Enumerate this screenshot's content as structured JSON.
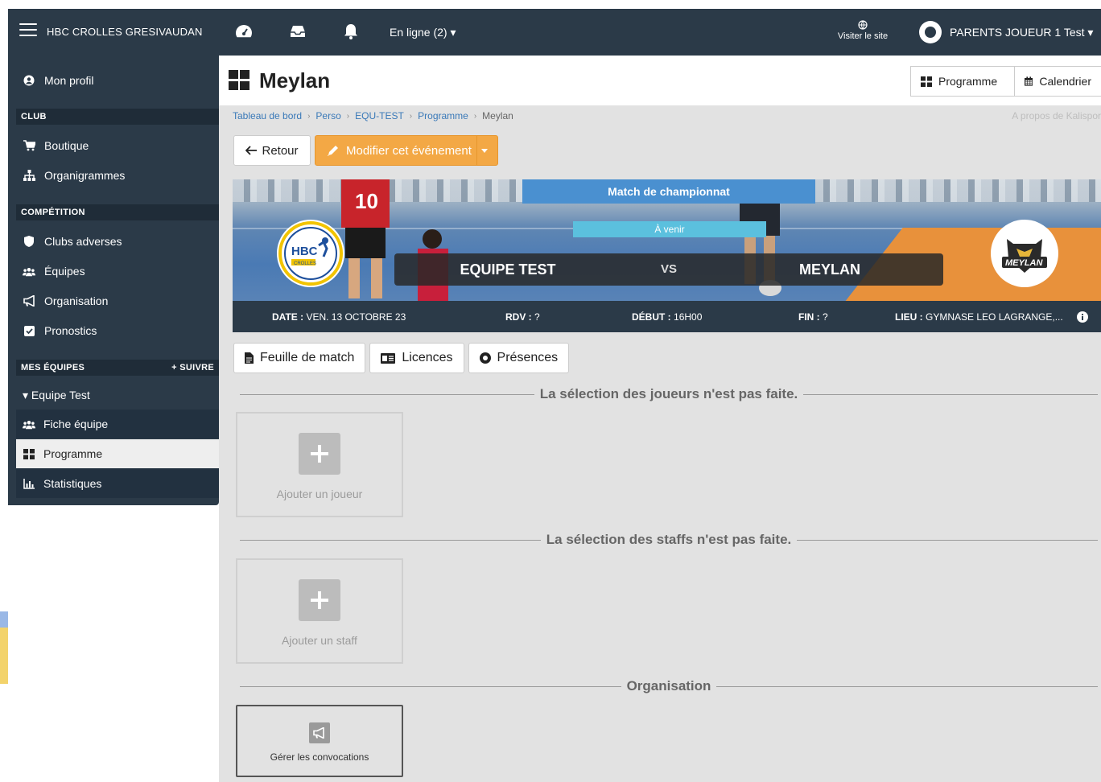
{
  "topbar": {
    "brand": "HBC CROLLES GRESIVAUDAN",
    "online_label": "En ligne (2) ▾",
    "visit_site": "Visiter le site",
    "user_name": "PARENTS JOUEUR 1 Test ▾",
    "icons": [
      "menu-icon",
      "dashboard-icon",
      "inbox-icon",
      "bell-icon",
      "globe-icon",
      "avatar"
    ]
  },
  "sidebar": {
    "profile": "Mon profil",
    "sections": {
      "club": "CLUB",
      "competition": "COMPÉTITION",
      "my_teams": "MES ÉQUIPES",
      "follow": "+ SUIVRE"
    },
    "club_items": [
      "Boutique",
      "Organigrammes"
    ],
    "competition_items": [
      "Clubs adverses",
      "Équipes",
      "Organisation",
      "Pronostics"
    ],
    "team_name": "▾  Equipe Test",
    "team_items": [
      "Fiche équipe",
      "Programme",
      "Statistiques"
    ]
  },
  "page": {
    "title": "Meylan",
    "btn_programme": "Programme",
    "btn_calendar": "Calendrier",
    "breadcrumb": [
      "Tableau de bord",
      "Perso",
      "EQU-TEST",
      "Programme",
      "Meylan"
    ],
    "about": "A propos de Kalispor",
    "back": "Retour",
    "edit": "Modifier cet événement"
  },
  "match": {
    "type": "Match de championnat",
    "status": "À venir",
    "home": "EQUIPE TEST",
    "vs": "VS",
    "away": "MEYLAN",
    "date_label": "DATE :",
    "date": "VEN. 13 OCTOBRE 23",
    "rdv_label": "RDV :",
    "rdv": "?",
    "start_label": "DÉBUT :",
    "start": "16H00",
    "end_label": "FIN :",
    "end": "?",
    "place_label": "LIEU :",
    "place": "GYMNASE LEO LAGRANGE,...",
    "home_logo": "HBC",
    "home_logo_sub": "CROLLES",
    "away_logo": "MEYLAN"
  },
  "tabs": [
    "Feuille de match",
    "Licences",
    "Présences"
  ],
  "sections": {
    "players_title": "La sélection des joueurs n'est pas faite.",
    "add_player": "Ajouter un joueur",
    "staff_title": "La sélection des staffs n'est pas faite.",
    "add_staff": "Ajouter un staff",
    "org_title": "Organisation",
    "convocations": "Gérer les convocations"
  },
  "colors": {
    "navbar": "#2b3a48",
    "accent_orange": "#f3a845",
    "match_label_blue": "#4a90d0",
    "status_cyan": "#5bc0de",
    "link_blue": "#3a79b8"
  }
}
